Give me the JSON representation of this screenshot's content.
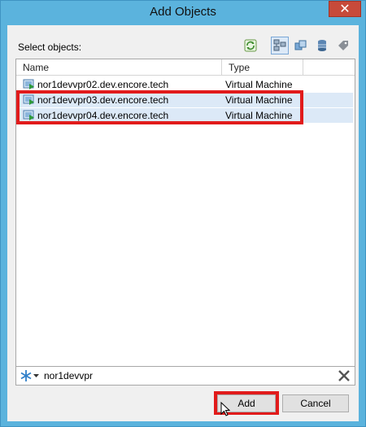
{
  "window": {
    "title": "Add Objects",
    "close_glyph": "✕"
  },
  "select_label": "Select objects:",
  "toolbar": {
    "icons": [
      "refresh-icon",
      "hosts-and-clusters-icon",
      "vms-and-templates-icon",
      "datastores-icon",
      "tags-icon"
    ],
    "active": "hosts-and-clusters-icon"
  },
  "list": {
    "columns": [
      "Name",
      "Type"
    ],
    "rows": [
      {
        "name": "nor1devvpr02.dev.encore.tech",
        "type": "Virtual Machine",
        "selected": false
      },
      {
        "name": "nor1devvpr03.dev.encore.tech",
        "type": "Virtual Machine",
        "selected": true
      },
      {
        "name": "nor1devvpr04.dev.encore.tech",
        "type": "Virtual Machine",
        "selected": true
      }
    ]
  },
  "search": {
    "value": "nor1devvpr"
  },
  "buttons": {
    "add": "Add",
    "cancel": "Cancel"
  },
  "colors": {
    "highlight": "#e11b1b",
    "selection": "#dce9f7",
    "titlebar": "#5bb3dd"
  }
}
